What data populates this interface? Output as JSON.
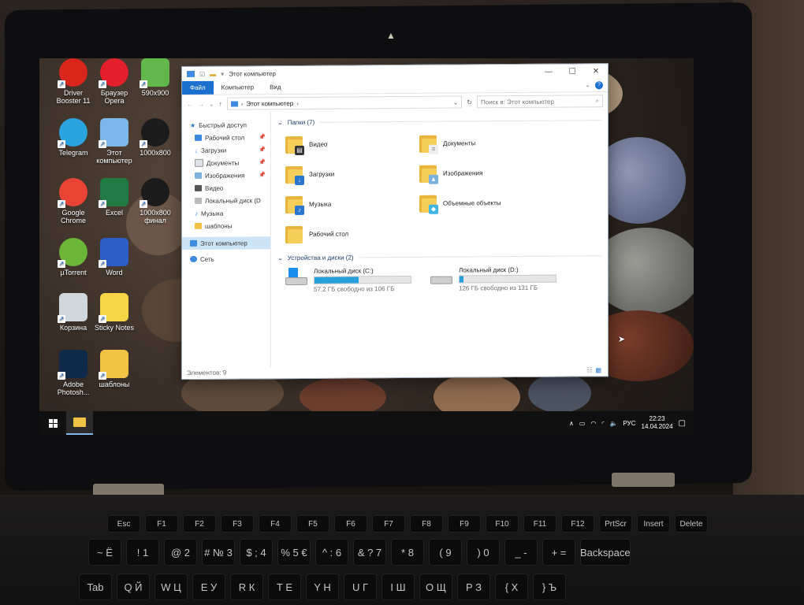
{
  "desktop": {
    "icons": [
      {
        "label": "Driver\nBooster 11",
        "icon": "driver-booster-icon",
        "color": "#d9261c"
      },
      {
        "label": "Браузер\nOpera",
        "icon": "opera-icon",
        "color": "#e3202b"
      },
      {
        "label": "590x900",
        "icon": "image-file-icon",
        "color": "#62b84a"
      },
      {
        "label": "Telegram",
        "icon": "telegram-icon",
        "color": "#2aa3de"
      },
      {
        "label": "Этот\nкомпьютер",
        "icon": "this-pc-icon",
        "color": "#7bb7e8"
      },
      {
        "label": "1000x800",
        "icon": "switch-file-icon",
        "color": "#1c1c1c"
      },
      {
        "label": "Google\nChrome",
        "icon": "chrome-icon",
        "color": "#e94335"
      },
      {
        "label": "Excel",
        "icon": "excel-icon",
        "color": "#1f7a44"
      },
      {
        "label": "1000x800\nфинал",
        "icon": "switch-file-icon",
        "color": "#1c1c1c"
      },
      {
        "label": "µTorrent",
        "icon": "utorrent-icon",
        "color": "#6bb539"
      },
      {
        "label": "Word",
        "icon": "word-icon",
        "color": "#2b5fc7"
      },
      {
        "label": "Корзина",
        "icon": "recycle-bin-icon",
        "color": "#cfd6dc"
      },
      {
        "label": "Sticky Notes",
        "icon": "sticky-notes-icon",
        "color": "#f7d547"
      },
      {
        "label": "Adobe\nPhotosh...",
        "icon": "photoshop-icon",
        "color": "#0f2a4a"
      },
      {
        "label": "шаблоны",
        "icon": "folder-icon",
        "color": "#f1c244"
      }
    ]
  },
  "explorer": {
    "title": "Этот компьютер",
    "ribbon_tabs": [
      "Файл",
      "Компьютер",
      "Вид"
    ],
    "address": "Этот компьютер",
    "search_placeholder": "Поиск в: Этот компьютер",
    "nav": {
      "quick_access": "Быстрый доступ",
      "items": [
        "Рабочий стол",
        "Загрузки",
        "Документы",
        "Изображения",
        "Видео",
        "Локальный диск (D",
        "Музыка",
        "шаблоны"
      ],
      "this_pc": "Этот компьютер",
      "network": "Сеть"
    },
    "folders_header": "Папки (7)",
    "folders": [
      "Видео",
      "Документы",
      "Загрузки",
      "Изображения",
      "Музыка",
      "Объемные объекты",
      "Рабочий стол"
    ],
    "devices_header": "Устройства и диски (2)",
    "drives": [
      {
        "name": "Локальный диск (C:)",
        "free": "57,2 ГБ свободно из 106 ГБ",
        "used_fraction": 0.46
      },
      {
        "name": "Локальный диск (D:)",
        "free": "126 ГБ свободно из 131 ГБ",
        "used_fraction": 0.04
      }
    ],
    "status": "Элементов: 9"
  },
  "taskbar": {
    "language": "РУС",
    "time": "22:23",
    "date": "14.04.2024"
  },
  "keyboard": {
    "fn_row": [
      "Esc",
      "F1",
      "F2",
      "F3",
      "F4",
      "F5",
      "F6",
      "F7",
      "F8",
      "F9",
      "F10",
      "F11",
      "F12",
      "PrtScr",
      "Insert",
      "Delete"
    ],
    "num_row": [
      "~ Ё",
      "! 1",
      "@ 2",
      "# № 3",
      "$ ; 4",
      "% 5 €",
      "^ : 6",
      "& ? 7",
      "* 8",
      "( 9",
      ") 0",
      "_ -",
      "+ =",
      "Backspace"
    ],
    "q_row": [
      "Tab",
      "Q Й",
      "W Ц",
      "E У",
      "R К",
      "T Е",
      "Y Н",
      "U Г",
      "I Ш",
      "O Щ",
      "P З",
      "{ Х",
      "} Ъ"
    ]
  }
}
